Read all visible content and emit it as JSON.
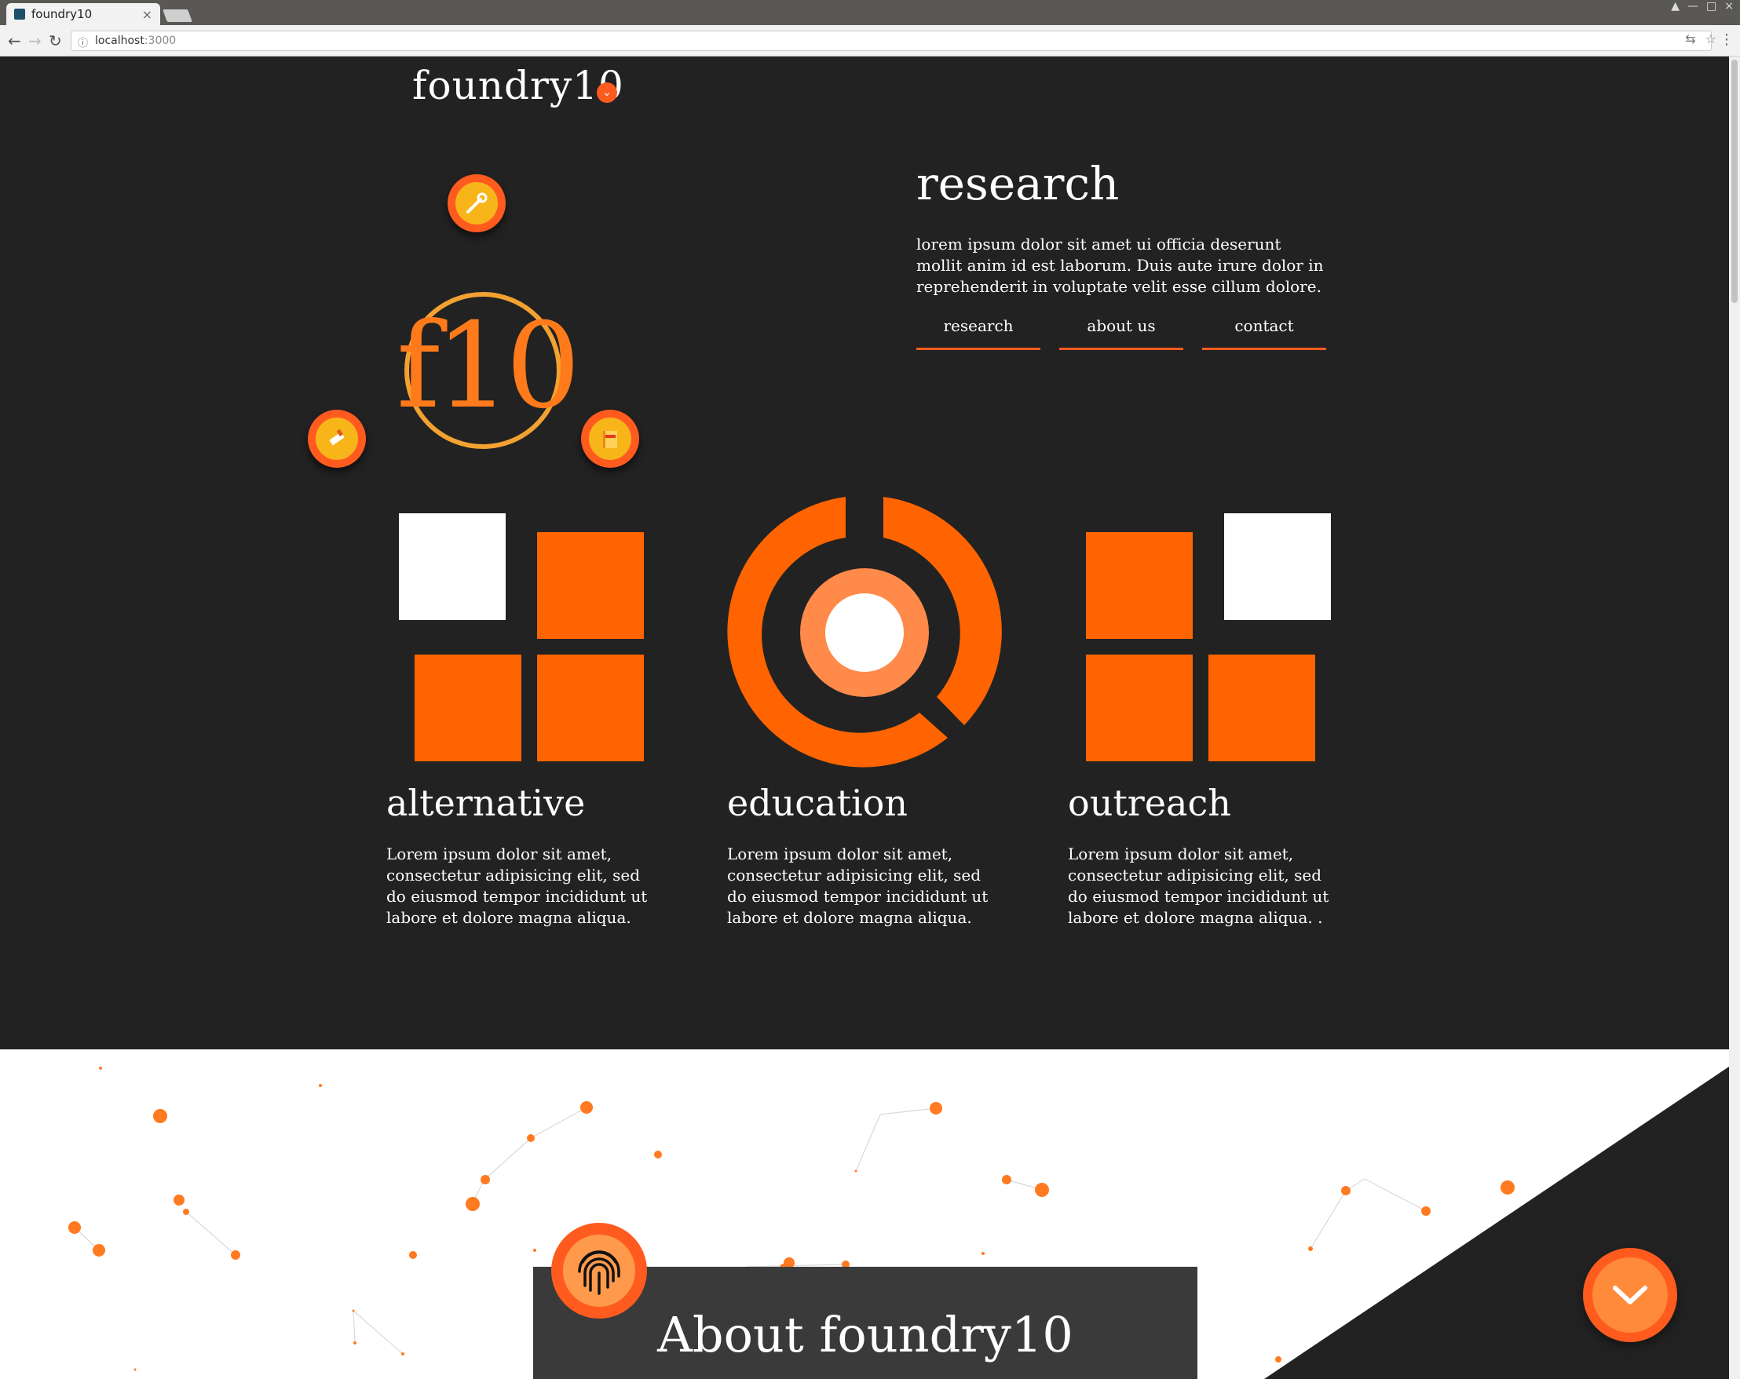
{
  "browser": {
    "tab_title": "foundry10",
    "tab_close": "×",
    "url_host": "localhost",
    "url_port": ":3000",
    "window_controls": [
      "▲",
      "—",
      "□",
      "×"
    ]
  },
  "header": {
    "brand": "foundry10",
    "menu_toggle_glyph": "⌄"
  },
  "hero": {
    "logo_text": "f10",
    "orbit_icons": [
      "wrench-icon",
      "pencil-icon",
      "book-icon"
    ]
  },
  "research": {
    "title": "research",
    "body": "lorem ipsum dolor sit amet ui officia deserunt mollit anim id est laborum. Duis aute irure dolor in reprehenderit in voluptate velit esse cillum dolore.",
    "tabs": [
      "research",
      "about us",
      "contact"
    ]
  },
  "columns": [
    {
      "title": "alternative",
      "body": "Lorem ipsum dolor sit amet, consectetur adipisicing elit, sed do eiusmod tempor incididunt ut labore et dolore magna aliqua."
    },
    {
      "title": "education",
      "body": "Lorem ipsum dolor sit amet, consectetur adipisicing elit, sed do eiusmod tempor incididunt ut labore et dolore magna aliqua."
    },
    {
      "title": "outreach",
      "body": "Lorem ipsum dolor sit amet, consectetur adipisicing elit, sed do eiusmod tempor incididunt ut labore et dolore magna aliqua. ."
    }
  ],
  "about": {
    "title": "About foundry10"
  },
  "colors": {
    "accent": "#ff6400",
    "accent_dark": "#ff5b1f",
    "dark_bg": "#222222",
    "card_bg": "#3a3a3a"
  }
}
